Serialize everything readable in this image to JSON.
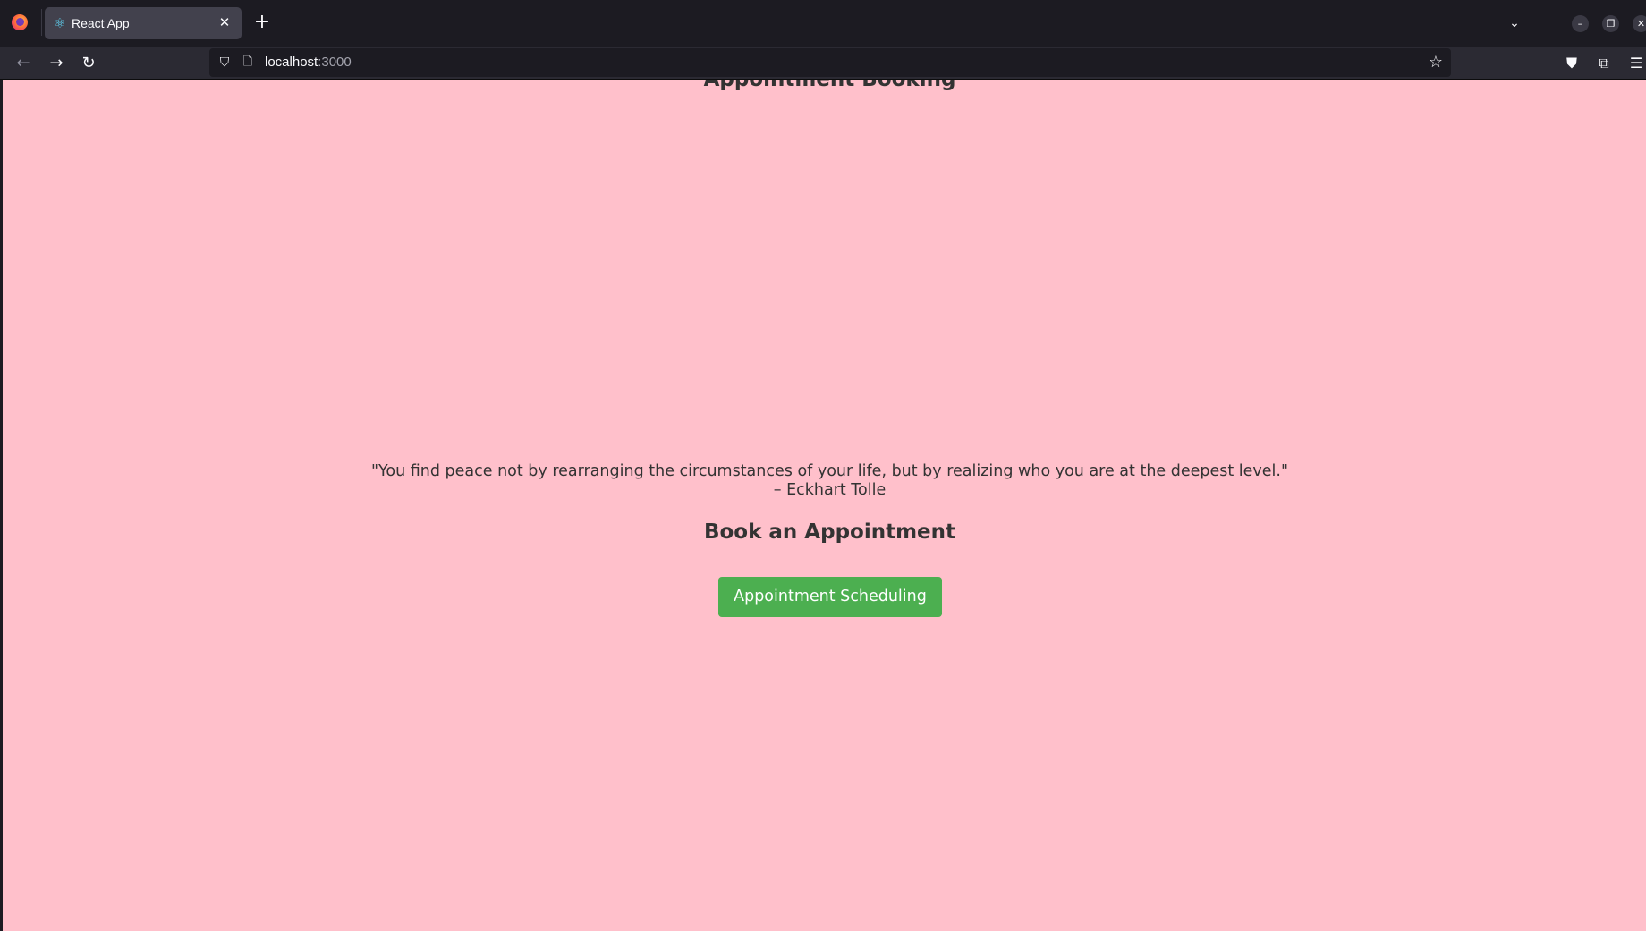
{
  "browser": {
    "tab": {
      "title": "React App",
      "favicon": "react-icon",
      "close_glyph": "✕"
    },
    "new_tab_glyph": "+",
    "url": {
      "host": "localhost",
      "port": ":3000"
    },
    "icons": [
      "firefox-logo-icon",
      "back-arrow-icon",
      "forward-arrow-icon",
      "reload-icon",
      "shield-icon",
      "page-icon",
      "star-icon",
      "pocket-icon",
      "extensions-icon",
      "menu-icon",
      "tab-list-chevron-icon",
      "minimize-icon",
      "restore-icon",
      "close-window-icon"
    ]
  },
  "page": {
    "heading": "Appointment Booking",
    "quote": "\"You find peace not by rearranging the circumstances of your life, but by realizing who you are at the deepest level.\"",
    "quote_author": "– Eckhart Tolle",
    "book_heading": "Book an Appointment",
    "schedule_button": "Appointment Scheduling"
  },
  "colors": {
    "page_background": "#ffc0cb",
    "button_background": "#4caf50",
    "button_text": "#ffffff",
    "text": "#333333"
  }
}
